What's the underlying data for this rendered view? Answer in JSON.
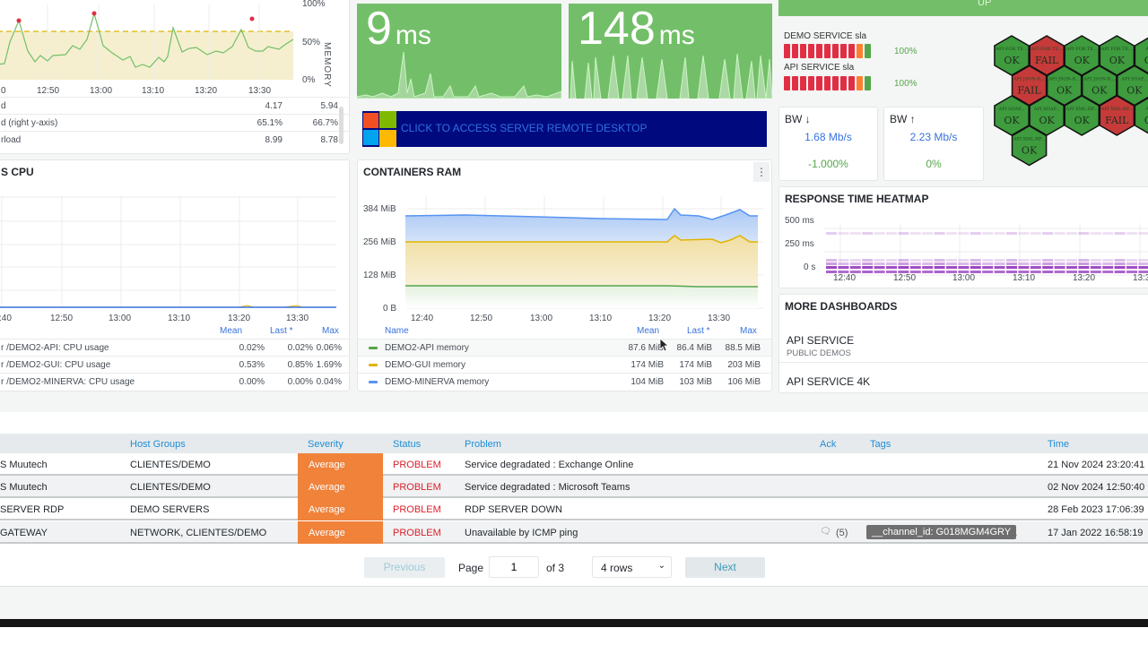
{
  "memory_panel": {
    "right_axis_label": "MEMORY",
    "y_ticks": [
      "100%",
      "50%",
      "0%"
    ],
    "x_ticks": [
      "0",
      "12:50",
      "13:00",
      "13:10",
      "13:20",
      "13:30"
    ],
    "legend": [
      {
        "name": "d",
        "mean": "4.17",
        "max": "5.94"
      },
      {
        "name": "d (right y-axis)",
        "mean": "65.1%",
        "max": "66.7%"
      },
      {
        "name": "rload",
        "mean": "8.99",
        "max": "8.78"
      }
    ]
  },
  "stat_1": {
    "value": "9",
    "unit": "ms"
  },
  "stat_2": {
    "value": "148",
    "unit": "ms"
  },
  "status_bar": {
    "text": "UP"
  },
  "rdp_banner": {
    "label": "CLICK TO ACCESS SERVER REMOTE DESKTOP",
    "icon": "windows-logo"
  },
  "sla": [
    {
      "label": "DEMO SERVICE sla",
      "pct": "100%"
    },
    {
      "label": "API SERVICE sla",
      "pct": "100%"
    }
  ],
  "bw_down": {
    "title": "BW ↓",
    "value": "1.68 Mb/s",
    "pct": "-1.000%"
  },
  "bw_up": {
    "title": "BW ↑",
    "value": "2.23 Mb/s",
    "pct": "0%"
  },
  "hexagons": [
    {
      "label": "API FOR TE...",
      "state": "OK"
    },
    {
      "label": "API FOR TE...",
      "state": "FAIL"
    },
    {
      "label": "API FOR TE...",
      "state": "OK"
    },
    {
      "label": "API FOR TE...",
      "state": "OK"
    },
    {
      "label": "API...",
      "state": "OK"
    },
    {
      "label": "API JSON-R...",
      "state": "FAIL"
    },
    {
      "label": "API JSON-R...",
      "state": "OK"
    },
    {
      "label": "API JSON-R...",
      "state": "OK"
    },
    {
      "label": "API SOAP...",
      "state": "OK"
    },
    {
      "label": "API SOAP...",
      "state": "OK"
    },
    {
      "label": "API SOAP...",
      "state": "OK"
    },
    {
      "label": "API XML-RP...",
      "state": "OK"
    },
    {
      "label": "API XML-RP...",
      "state": "FAIL"
    },
    {
      "label": "API...",
      "state": "OK"
    },
    {
      "label": "API XML-RP...",
      "state": "OK"
    }
  ],
  "cpu_panel": {
    "title": "S CPU",
    "x_ticks": [
      ":40",
      "12:50",
      "13:00",
      "13:10",
      "13:20",
      "13:30"
    ],
    "headers": {
      "mean": "Mean",
      "last": "Last *",
      "max": "Max"
    },
    "legend": [
      {
        "name": "r /DEMO2-API: CPU usage",
        "mean": "0.02%",
        "last": "0.02%",
        "max": "0.06%"
      },
      {
        "name": "r /DEMO2-GUI: CPU usage",
        "mean": "0.53%",
        "last": "0.85%",
        "max": "1.69%"
      },
      {
        "name": "r /DEMO2-MINERVA: CPU usage",
        "mean": "0.00%",
        "last": "0.00%",
        "max": "0.04%"
      }
    ]
  },
  "ram_panel": {
    "title": "CONTAINERS RAM",
    "y_ticks": [
      "384 MiB",
      "256 MiB",
      "128 MiB",
      "0 B"
    ],
    "x_ticks": [
      "12:40",
      "12:50",
      "13:00",
      "13:10",
      "13:20",
      "13:30"
    ],
    "headers": {
      "name": "Name",
      "mean": "Mean",
      "last": "Last *",
      "max": "Max"
    },
    "legend": [
      {
        "name": "DEMO2-API memory",
        "color": "#56a64b",
        "mean": "87.6 MiB",
        "last": "86.4 MiB",
        "max": "88.5 MiB"
      },
      {
        "name": "DEMO-GUI memory",
        "color": "#e0b400",
        "mean": "174 MiB",
        "last": "174 MiB",
        "max": "203 MiB"
      },
      {
        "name": "DEMO-MINERVA memory",
        "color": "#5794f2",
        "mean": "104 MiB",
        "last": "103 MiB",
        "max": "106 MiB"
      }
    ]
  },
  "heatmap_panel": {
    "title": "RESPONSE TIME HEATMAP",
    "y_ticks": [
      "500 ms",
      "250 ms",
      "0 s"
    ],
    "x_ticks": [
      "12:40",
      "12:50",
      "13:00",
      "13:10",
      "13:20",
      "13:30"
    ]
  },
  "more_dashboards": {
    "title": "MORE DASHBOARDS",
    "items": [
      {
        "name": "API SERVICE",
        "folder": "PUBLIC DEMOS"
      },
      {
        "name": "API SERVICE 4K",
        "folder": ""
      }
    ]
  },
  "problems": {
    "headers": {
      "host_groups": "Host Groups",
      "severity": "Severity",
      "status": "Status",
      "problem": "Problem",
      "ack": "Ack",
      "tags": "Tags",
      "time": "Time"
    },
    "rows": [
      {
        "host": "S Muutech",
        "groups": "CLIENTES/DEMO",
        "severity": "Average",
        "status": "PROBLEM",
        "problem": "Service degradated : Exchange Online",
        "ack": "",
        "tag": "",
        "time": "21 Nov 2024 23:20:41"
      },
      {
        "host": "S Muutech",
        "groups": "CLIENTES/DEMO",
        "severity": "Average",
        "status": "PROBLEM",
        "problem": "Service degradated : Microsoft Teams",
        "ack": "",
        "tag": "",
        "time": "02 Nov 2024 12:50:40"
      },
      {
        "host": "SERVER RDP",
        "groups": "DEMO SERVERS",
        "severity": "Average",
        "status": "PROBLEM",
        "problem": "RDP SERVER DOWN",
        "ack": "",
        "tag": "",
        "time": "28 Feb 2023 17:06:39"
      },
      {
        "host": "GATEWAY",
        "groups": "NETWORK, CLIENTES/DEMO",
        "severity": "Average",
        "status": "PROBLEM",
        "problem": "Unavailable by ICMP ping",
        "ack": "(5)",
        "tag": "__channel_id: G018MGM4GRY",
        "time": "17 Jan 2022 16:58:19"
      }
    ],
    "pagination": {
      "previous": "Previous",
      "page_label": "Page",
      "page_value": "1",
      "of_label": "of 3",
      "rows_option": "4 rows",
      "next": "Next"
    }
  }
}
